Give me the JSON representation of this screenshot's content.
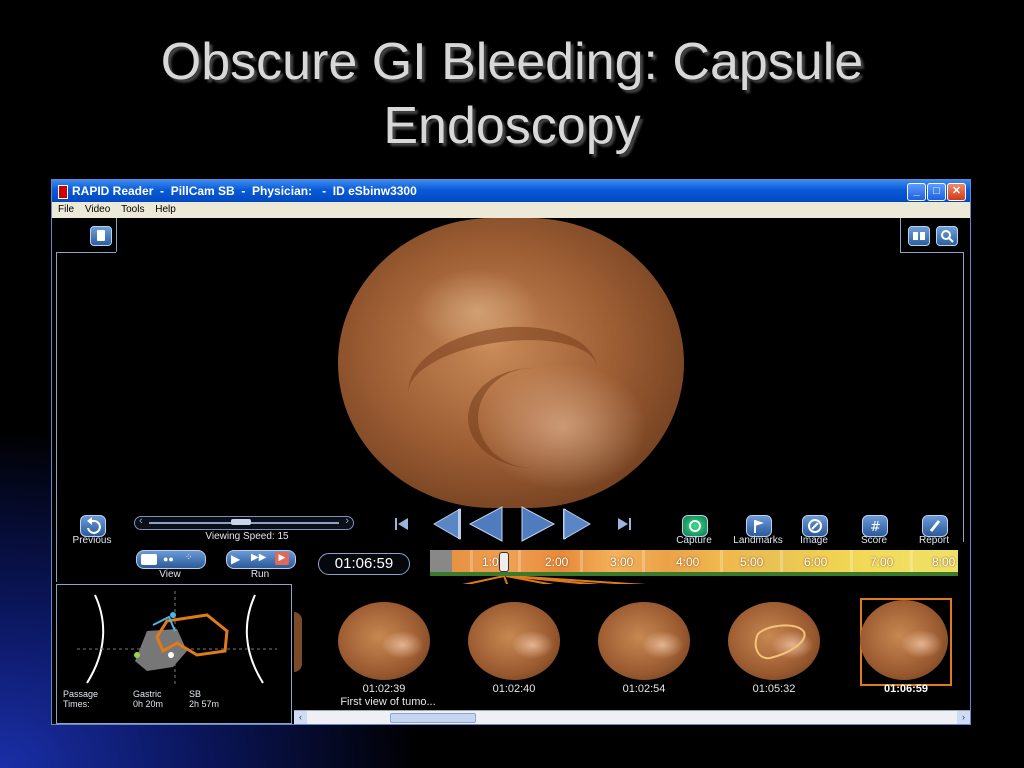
{
  "slide": {
    "title_line1": "Obscure GI Bleeding: Capsule",
    "title_line2": "Endoscopy"
  },
  "window": {
    "title": "RAPID Reader  -  PillCam SB  -  Physician:   -  ID eSbinw3300",
    "controls": {
      "minimize": "_",
      "maximize": "□",
      "close": "✕"
    }
  },
  "menu": [
    "File",
    "Video",
    "Tools",
    "Help"
  ],
  "player": {
    "previous_label": "Previous",
    "viewing_speed_label": "Viewing Speed: 15",
    "view_label": "View",
    "run_label": "Run",
    "current_time": "01:06:59",
    "actions": [
      {
        "label": "Capture",
        "icon": "capture-icon"
      },
      {
        "label": "Landmarks",
        "icon": "flag-icon"
      },
      {
        "label": "Image",
        "icon": "image-icon"
      },
      {
        "label": "Score",
        "icon": "hash-icon"
      },
      {
        "label": "Report",
        "icon": "pencil-icon"
      }
    ]
  },
  "timeline": {
    "ticks": [
      "1:00",
      "2:00",
      "3:00",
      "4:00",
      "5:00",
      "6:00",
      "7:00",
      "8:00"
    ]
  },
  "passage": {
    "label_line1": "Passage",
    "label_line2": "Times:",
    "gastric_label": "Gastric",
    "gastric_value": "0h 20m",
    "sb_label": "SB",
    "sb_value": "2h 57m"
  },
  "thumbnails": [
    {
      "time": "01:02:39",
      "caption": "First view of tumo..."
    },
    {
      "time": "01:02:40",
      "caption": ""
    },
    {
      "time": "01:02:54",
      "caption": ""
    },
    {
      "time": "01:05:32",
      "caption": ""
    },
    {
      "time": "01:06:59",
      "caption": "",
      "selected": true
    }
  ],
  "colors": {
    "titlebar": "#0a5ad8",
    "accent_orange": "#e07a1a",
    "frame": "#8aa4c6"
  }
}
